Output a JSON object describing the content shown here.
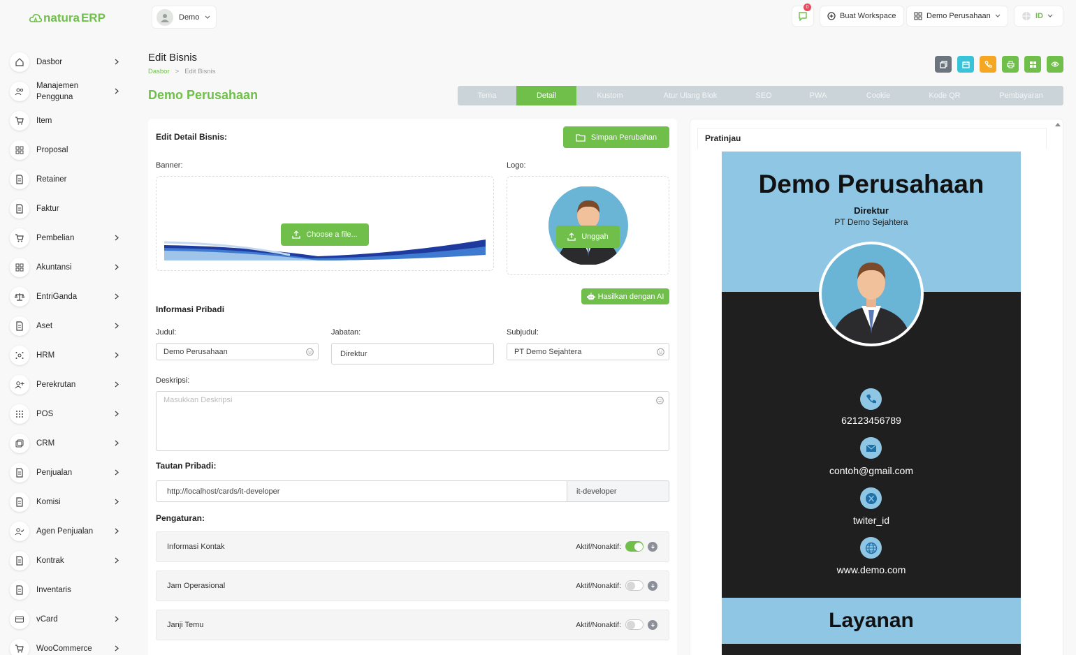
{
  "brand": {
    "logo_text_a": "natura",
    "logo_text_b": "ERP",
    "accent": "#6fbf4a"
  },
  "topbar": {
    "user_label": "Demo",
    "notif_count": "0",
    "workspace_btn": "Buat Workspace",
    "company_select": "Demo Perusahaan",
    "lang": "ID"
  },
  "sidebar": {
    "items": [
      {
        "label": "Dasbor",
        "icon": "home-icon",
        "chevron": true
      },
      {
        "label": "Manajemen Pengguna",
        "icon": "users-icon",
        "chevron": true
      },
      {
        "label": "Item",
        "icon": "cart-icon",
        "chevron": false
      },
      {
        "label": "Proposal",
        "icon": "grid-icon",
        "chevron": false
      },
      {
        "label": "Retainer",
        "icon": "doc-icon",
        "chevron": false
      },
      {
        "label": "Faktur",
        "icon": "doc-icon",
        "chevron": false
      },
      {
        "label": "Pembelian",
        "icon": "cart-icon",
        "chevron": true
      },
      {
        "label": "Akuntansi",
        "icon": "grid-icon",
        "chevron": true
      },
      {
        "label": "EntriGanda",
        "icon": "scale-icon",
        "chevron": true
      },
      {
        "label": "Aset",
        "icon": "doc-icon",
        "chevron": true
      },
      {
        "label": "HRM",
        "icon": "hrm-icon",
        "chevron": true
      },
      {
        "label": "Perekrutan",
        "icon": "user-plus-icon",
        "chevron": true
      },
      {
        "label": "POS",
        "icon": "dots-grid-icon",
        "chevron": true
      },
      {
        "label": "CRM",
        "icon": "crm-icon",
        "chevron": true
      },
      {
        "label": "Penjualan",
        "icon": "doc-icon",
        "chevron": true
      },
      {
        "label": "Komisi",
        "icon": "doc-icon",
        "chevron": true
      },
      {
        "label": "Agen Penjualan",
        "icon": "user-check-icon",
        "chevron": true
      },
      {
        "label": "Kontrak",
        "icon": "doc-icon",
        "chevron": true
      },
      {
        "label": "Inventaris",
        "icon": "doc-icon",
        "chevron": false
      },
      {
        "label": "vCard",
        "icon": "card-icon",
        "chevron": true
      },
      {
        "label": "WooCommerce",
        "icon": "cart-icon",
        "chevron": true
      }
    ]
  },
  "header": {
    "title": "Edit Bisnis",
    "breadcrumb": [
      "Dasbor",
      ">",
      "Edit Bisnis"
    ],
    "business_name": "Demo Perusahaan"
  },
  "tabs": [
    "Tema",
    "Detail",
    "Kustom",
    "Atur Ulang Blok",
    "SEO",
    "PWA",
    "Cookie",
    "Kode QR",
    "Pembayaran"
  ],
  "action_colors": [
    "#6c757d",
    "#39c3d8",
    "#f5a623",
    "#6fbf4a",
    "#6fbf4a",
    "#6fbf4a"
  ],
  "form": {
    "section_title": "Edit Detail Bisnis:",
    "save_btn": "Simpan Perubahan",
    "banner_label": "Banner:",
    "choose_file_btn": "Choose a file...",
    "logo_label": "Logo:",
    "upload_btn": "Unggah",
    "ai_btn": "Hasilkan dengan AI",
    "personal_info": "Informasi Pribadi",
    "title_label": "Judul:",
    "title_value": "Demo Perusahaan",
    "position_label": "Jabatan:",
    "position_value": "Direktur",
    "subtitle_label": "Subjudul:",
    "subtitle_value": "PT Demo Sejahtera",
    "desc_label": "Deskripsi:",
    "desc_placeholder": "Masukkan Deskripsi",
    "link_label": "Tautan Pribadi:",
    "link_base": "http://localhost/cards/it-developer",
    "link_slug": "it-developer",
    "settings_label": "Pengaturan:",
    "settings": [
      {
        "label": "Informasi Kontak",
        "toggle_label": "Aktif/Nonaktif:",
        "on": true
      },
      {
        "label": "Jam Operasional",
        "toggle_label": "Aktif/Nonaktif:",
        "on": false
      },
      {
        "label": "Janji Temu",
        "toggle_label": "Aktif/Nonaktif:",
        "on": false
      }
    ]
  },
  "preview": {
    "title": "Pratinjau",
    "name": "Demo Perusahaan",
    "role": "Direktur",
    "company": "PT Demo Sejahtera",
    "phone": "62123456789",
    "email": "contoh@gmail.com",
    "twitter": "twiter_id",
    "website": "www.demo.com",
    "services": "Layanan",
    "colors": {
      "primary": "#8ec6e4",
      "dark": "#1f1f1f"
    }
  }
}
